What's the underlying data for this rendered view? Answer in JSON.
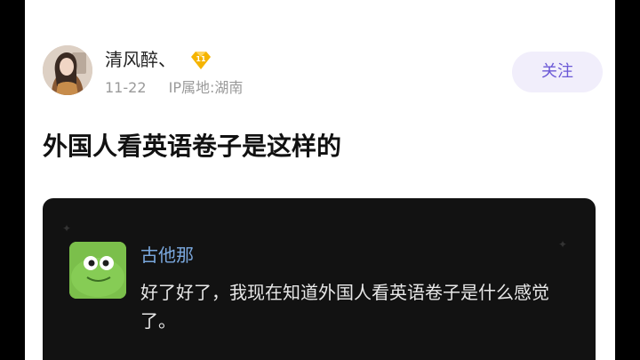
{
  "author": {
    "name": "清风醉、",
    "level": "11",
    "date": "11-22",
    "ip_location": "IP属地:湖南"
  },
  "follow": {
    "label": "关注"
  },
  "post": {
    "title": "外国人看英语卷子是这样的"
  },
  "comment": {
    "username": "古他那",
    "text": "好了好了，我现在知道外国人看英语卷子是什么感觉了。"
  },
  "colors": {
    "accent": "#6b58d6",
    "follow_bg": "#f1eefb",
    "badge": "#f5b400",
    "comment_name": "#7aa8de",
    "card_bg": "#121212"
  }
}
